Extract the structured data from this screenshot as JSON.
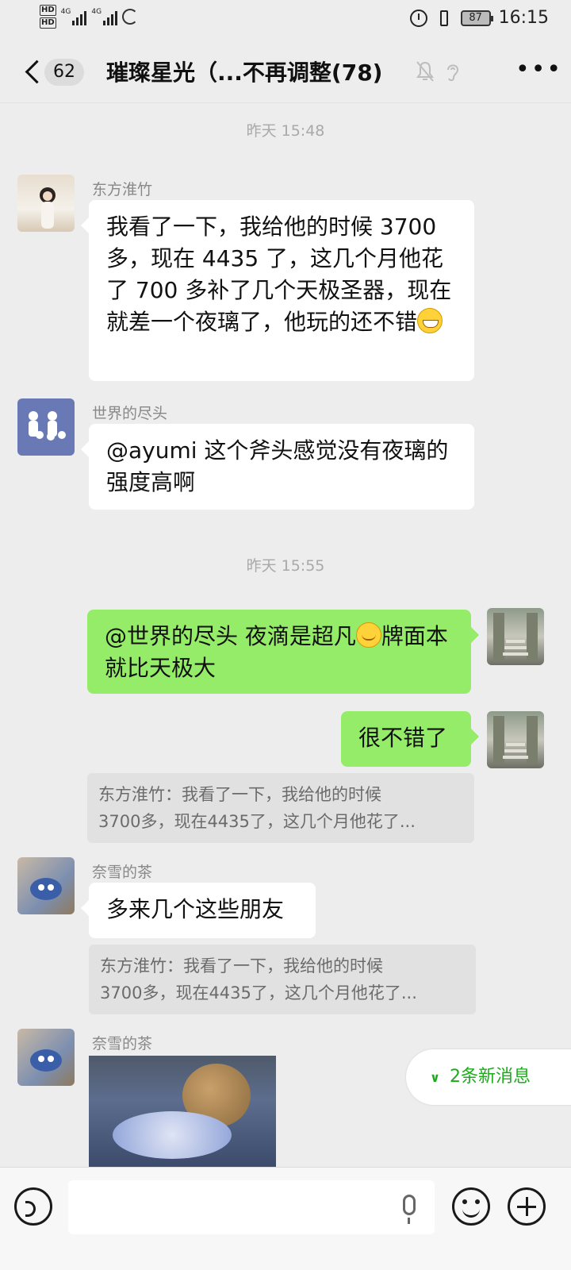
{
  "status_bar": {
    "hd_1": "HD",
    "hd_2": "HD",
    "net_1": "4G",
    "net_2": "4G",
    "battery": "87",
    "time": "16:15"
  },
  "header": {
    "badge": "62",
    "title": "璀璨星光（...不再调整(78)",
    "icons": [
      "back-icon",
      "mute-bell-icon",
      "ear-icon",
      "more-icon"
    ]
  },
  "timestamps": [
    "昨天 15:48",
    "昨天 15:55"
  ],
  "messages": [
    {
      "sender": "东方淮竹",
      "text": "我看了一下，我给他的时候 3700 多，现在 4435 了，这几个月他花了 700 多补了几个天极圣器，现在就差一个夜璃了，他玩的还不错"
    },
    {
      "sender": "世界的尽头",
      "text": "@ayumi  这个斧头感觉没有夜璃的强度高啊"
    },
    {
      "sender": "",
      "text_before": "@世界的尽头  夜滴是超凡",
      "text_after": "牌面本就比天极大"
    },
    {
      "sender": "",
      "text": "很不错了",
      "quote_line1": "东方淮竹：我看了一下，我给他的时候",
      "quote_line2": "3700多，现在4435了，这几个月他花了..."
    },
    {
      "sender": "奈雪的茶",
      "text": "多来几个这些朋友",
      "quote_line1": "东方淮竹：我看了一下，我给他的时候",
      "quote_line2": "3700多，现在4435了，这几个月他花了..."
    },
    {
      "sender": "奈雪的茶"
    }
  ],
  "new_messages": "2条新消息"
}
